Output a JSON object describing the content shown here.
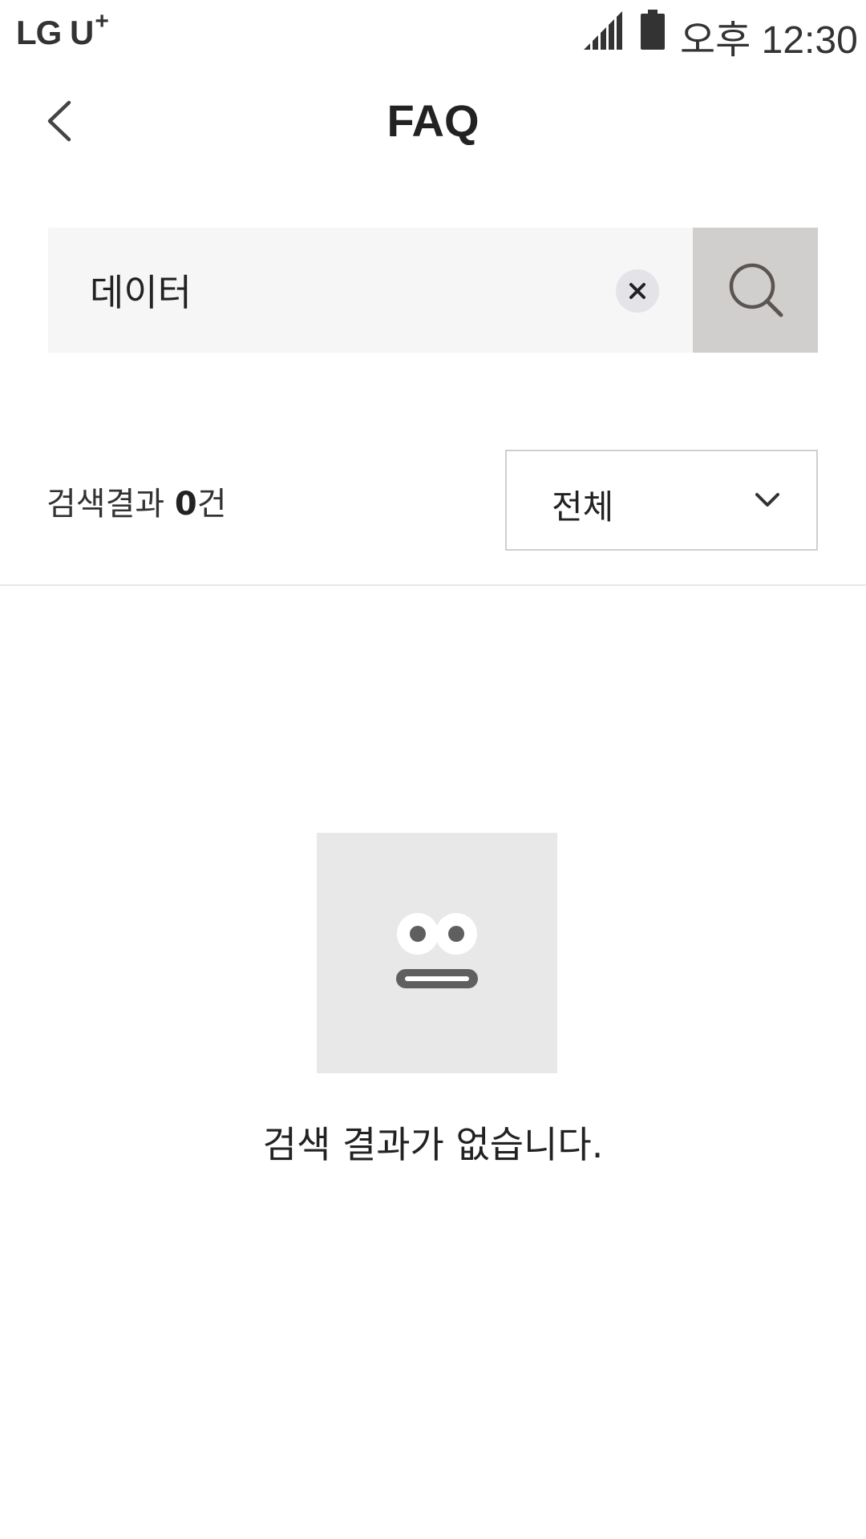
{
  "status_bar": {
    "carrier": "LG U",
    "carrier_plus": "+",
    "time": "오후 12:30"
  },
  "header": {
    "title": "FAQ"
  },
  "search": {
    "value": "데이터"
  },
  "results": {
    "label": "검색결과",
    "count": "0",
    "unit": "건"
  },
  "filter": {
    "selected": "전체"
  },
  "empty_state": {
    "message": "검색 결과가 없습니다."
  },
  "icons": {
    "back": "back-arrow-icon",
    "clear": "close-icon",
    "search": "search-icon",
    "dropdown": "chevron-down-icon",
    "empty": "empty-face-icon"
  },
  "colors": {
    "search_button_bg": "#d1cfce",
    "search_box_bg": "#f6f6f6",
    "empty_illustration_bg": "#e8e8e8"
  }
}
